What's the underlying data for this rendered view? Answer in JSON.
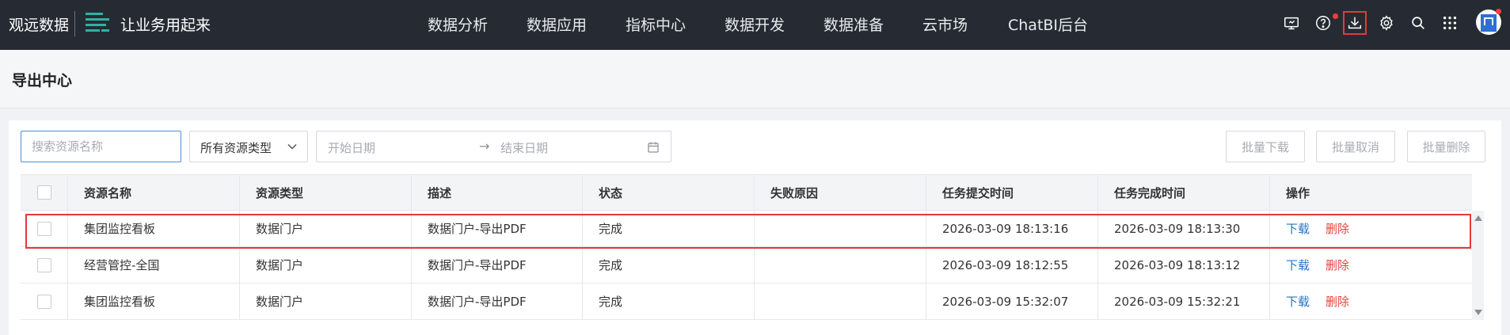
{
  "topbar": {
    "brand": "观远数据",
    "slogan": "让业务用起来",
    "nav": [
      "数据分析",
      "数据应用",
      "指标中心",
      "数据开发",
      "数据准备",
      "云市场",
      "ChatBI后台"
    ],
    "tools": [
      "monitor-icon",
      "help-icon",
      "download-icon",
      "gear-icon",
      "search-icon",
      "apps-grid-icon"
    ],
    "active_tool": "download-icon",
    "colors": {
      "bar_bg": "#262b33",
      "notification_dot": "#ff3b3b",
      "active_outline": "#e23a3a"
    }
  },
  "page": {
    "title": "导出中心"
  },
  "filters": {
    "search_placeholder": "搜索资源名称",
    "resource_type": "所有资源类型",
    "start_date_placeholder": "开始日期",
    "range_separator": "→",
    "end_date_placeholder": "结束日期"
  },
  "actions": {
    "batch_download": "批量下载",
    "batch_cancel": "批量取消",
    "batch_delete": "批量删除"
  },
  "table": {
    "headers": [
      "资源名称",
      "资源类型",
      "描述",
      "状态",
      "失败原因",
      "任务提交时间",
      "任务完成时间",
      "操作"
    ],
    "rows": [
      {
        "name": "集团监控看板",
        "type": "数据门户",
        "desc": "数据门户-导出PDF",
        "status": "完成",
        "reason": "",
        "submitted": "2026-03-09 18:13:16",
        "completed": "2026-03-09 18:13:30",
        "download": "下载",
        "delete": "删除"
      },
      {
        "name": "经营管控-全国",
        "type": "数据门户",
        "desc": "数据门户-导出PDF",
        "status": "完成",
        "reason": "",
        "submitted": "2026-03-09 18:12:55",
        "completed": "2026-03-09 18:13:12",
        "download": "下载",
        "delete": "删除"
      },
      {
        "name": "集团监控看板",
        "type": "数据门户",
        "desc": "数据门户-导出PDF",
        "status": "完成",
        "reason": "",
        "submitted": "2026-03-09 15:32:07",
        "completed": "2026-03-09 15:32:21",
        "download": "下载",
        "delete": "删除"
      }
    ],
    "highlighted_row": 0,
    "colors": {
      "link": "#2a72c9",
      "delete": "#e24545"
    }
  }
}
